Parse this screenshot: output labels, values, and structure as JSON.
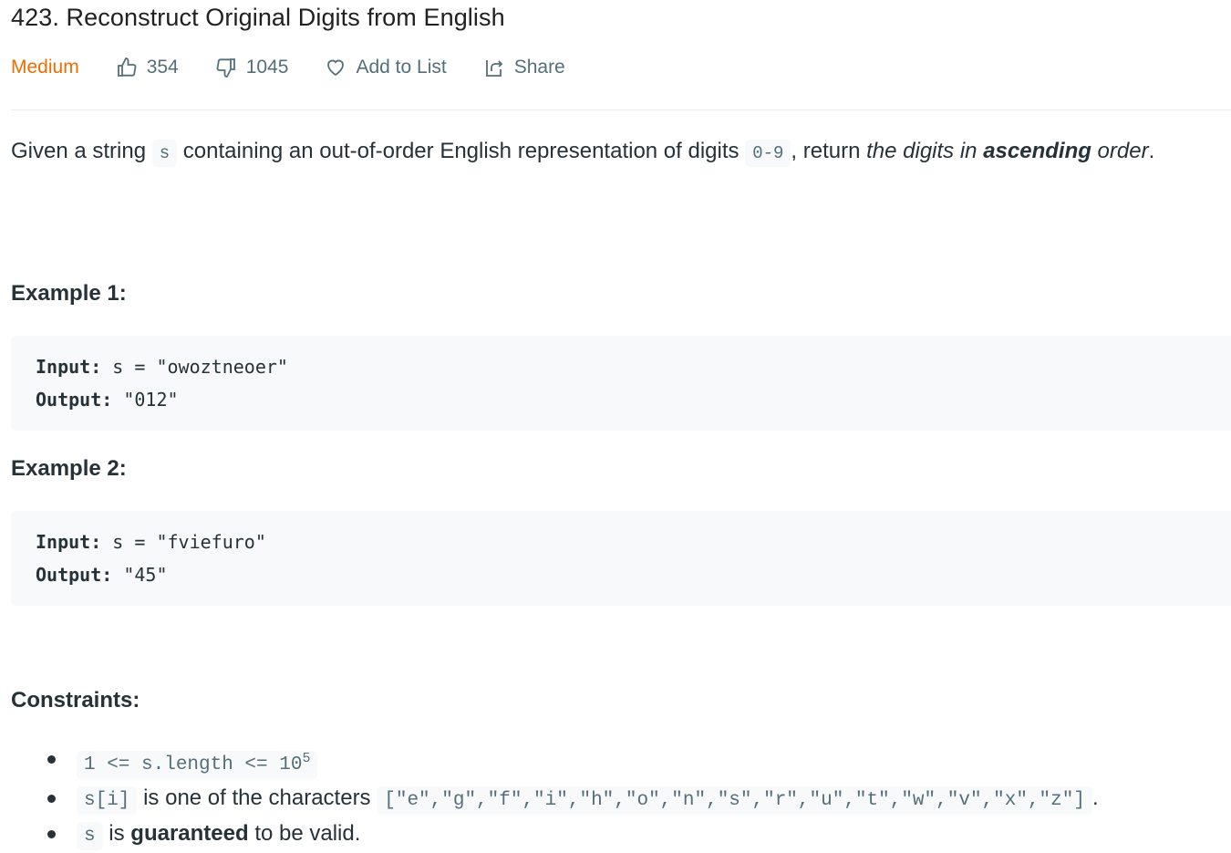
{
  "problem": {
    "title": "423. Reconstruct Original Digits from English",
    "difficulty": "Medium",
    "likes": "354",
    "dislikes": "1045",
    "add_to_list": "Add to List",
    "share": "Share"
  },
  "description": {
    "p1": "Given a string ",
    "code_s": "s",
    "p2": " containing an out-of-order English representation of digits ",
    "code_range": "0-9",
    "p3": ", return ",
    "italic": "the digits in ",
    "bold": "ascending",
    "italic2": " order",
    "end": "."
  },
  "examples": [
    {
      "heading": "Example 1:",
      "input_label": "Input:",
      "input": " s = \"owoztneoer\"",
      "output_label": "Output:",
      "output": " \"012\""
    },
    {
      "heading": "Example 2:",
      "input_label": "Input:",
      "input": " s = \"fviefuro\"",
      "output_label": "Output:",
      "output": " \"45\""
    }
  ],
  "constraints": {
    "heading": "Constraints:",
    "c1_code": "1 <= s.length <= 10",
    "c1_sup": "5",
    "c2_code": "s[i]",
    "c2_text": " is one of the characters ",
    "c2_chars": "[\"e\",\"g\",\"f\",\"i\",\"h\",\"o\",\"n\",\"s\",\"r\",\"u\",\"t\",\"w\",\"v\",\"x\",\"z\"]",
    "c2_end": ".",
    "c3_code": "s",
    "c3_text1": " is ",
    "c3_bold": "guaranteed",
    "c3_text2": " to be valid."
  },
  "colors": {
    "difficulty_medium": "#ef6c00",
    "code_bg": "#f7f9fa"
  }
}
